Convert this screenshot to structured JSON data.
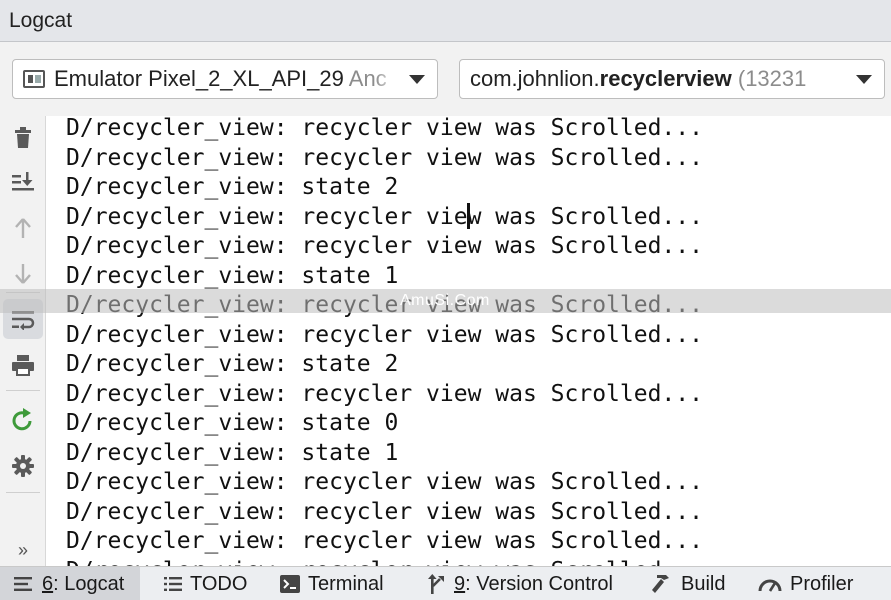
{
  "window": {
    "title": "Logcat"
  },
  "toolbar": {
    "device": {
      "name": "Emulator Pixel_2_XL_API_29",
      "suffix": "Anc"
    },
    "process": {
      "prefix": "com.johnlion.",
      "bold": "recyclerview",
      "pid": "(13231"
    }
  },
  "sidebar": {
    "tools": [
      "trash-icon",
      "scroll-to-end-icon",
      "up-arrow-icon",
      "down-arrow-icon",
      "soft-wrap-icon",
      "print-icon",
      "restart-icon",
      "settings-icon",
      "more-icon"
    ],
    "more_label": "»"
  },
  "log": {
    "lines": [
      "D/recycler_view: recycler view was Scrolled...",
      "D/recycler_view: recycler view was Scrolled...",
      "D/recycler_view: state 2",
      "D/recycler_view: recycler view was Scrolled...",
      "D/recycler_view: recycler view was Scrolled...",
      "D/recycler_view: state 1",
      "D/recycler_view: recycler view was Scrolled...",
      "D/recycler_view: recycler view was Scrolled...",
      "D/recycler_view: state 2",
      "D/recycler_view: recycler view was Scrolled...",
      "D/recycler_view: state 0",
      "D/recycler_view: state 1",
      "D/recycler_view: recycler view was Scrolled...",
      "D/recycler_view: recycler view was Scrolled...",
      "D/recycler_view: recycler view was Scrolled...",
      "D/recycler_view: recycler view was Scrolled..."
    ]
  },
  "watermark": "AmuSi.Com",
  "bottom_tabs": [
    {
      "key": "6",
      "label": ": Logcat",
      "icon": "logcat-icon"
    },
    {
      "key": "",
      "label": "TODO",
      "icon": "todo-icon"
    },
    {
      "key": "",
      "label": "Terminal",
      "icon": "terminal-icon"
    },
    {
      "key": "9",
      "label": ": Version Control",
      "icon": "version-control-icon"
    },
    {
      "key": "",
      "label": "Build",
      "icon": "hammer-icon"
    },
    {
      "key": "",
      "label": "Profiler",
      "icon": "gauge-icon"
    }
  ]
}
